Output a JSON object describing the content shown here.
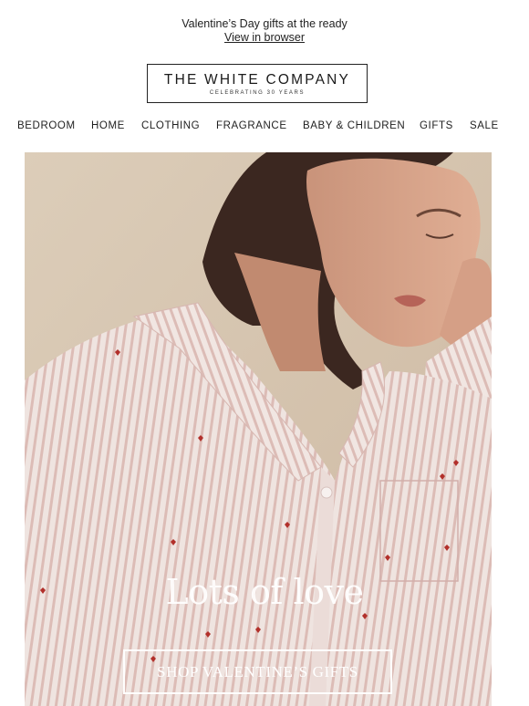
{
  "preheader": {
    "message": "Valentine’s Day gifts at the ready",
    "browser_link": "View in browser"
  },
  "logo": {
    "name": "THE WHITE COMPANY",
    "tagline": "CELEBRATING 30 YEARS"
  },
  "nav": {
    "items": [
      "BEDROOM",
      "HOME",
      "CLOTHING",
      "FRAGRANCE",
      "BABY & CHILDREN",
      "GIFTS",
      "SALE"
    ]
  },
  "hero": {
    "headline": "Lots of love",
    "cta_label": "SHOP VALENTINE’S GIFTS"
  },
  "colors": {
    "text": "#222222",
    "hero_background": "#d9cab6",
    "pajama_base": "#efe3df",
    "pajama_stripe": "#d9b6b0",
    "heart": "#b2302b",
    "cta_border": "#ffffff"
  }
}
